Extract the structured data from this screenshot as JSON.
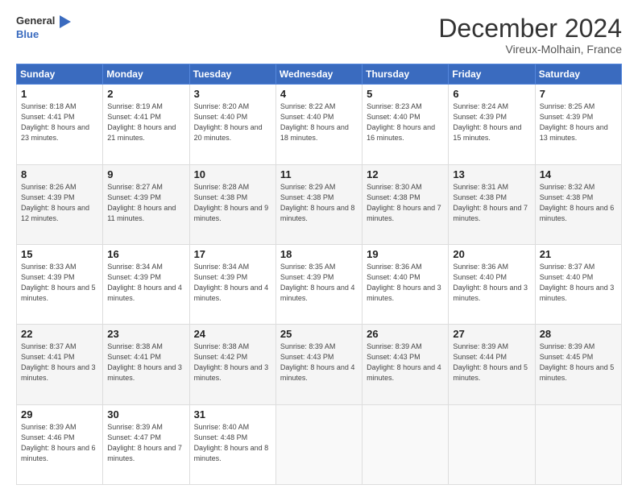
{
  "header": {
    "logo_line1": "General",
    "logo_line2": "Blue",
    "month": "December 2024",
    "location": "Vireux-Molhain, France"
  },
  "days_of_week": [
    "Sunday",
    "Monday",
    "Tuesday",
    "Wednesday",
    "Thursday",
    "Friday",
    "Saturday"
  ],
  "weeks": [
    [
      {
        "day": "1",
        "sunrise": "8:18 AM",
        "sunset": "4:41 PM",
        "daylight": "8 hours and 23 minutes."
      },
      {
        "day": "2",
        "sunrise": "8:19 AM",
        "sunset": "4:41 PM",
        "daylight": "8 hours and 21 minutes."
      },
      {
        "day": "3",
        "sunrise": "8:20 AM",
        "sunset": "4:40 PM",
        "daylight": "8 hours and 20 minutes."
      },
      {
        "day": "4",
        "sunrise": "8:22 AM",
        "sunset": "4:40 PM",
        "daylight": "8 hours and 18 minutes."
      },
      {
        "day": "5",
        "sunrise": "8:23 AM",
        "sunset": "4:40 PM",
        "daylight": "8 hours and 16 minutes."
      },
      {
        "day": "6",
        "sunrise": "8:24 AM",
        "sunset": "4:39 PM",
        "daylight": "8 hours and 15 minutes."
      },
      {
        "day": "7",
        "sunrise": "8:25 AM",
        "sunset": "4:39 PM",
        "daylight": "8 hours and 13 minutes."
      }
    ],
    [
      {
        "day": "8",
        "sunrise": "8:26 AM",
        "sunset": "4:39 PM",
        "daylight": "8 hours and 12 minutes."
      },
      {
        "day": "9",
        "sunrise": "8:27 AM",
        "sunset": "4:39 PM",
        "daylight": "8 hours and 11 minutes."
      },
      {
        "day": "10",
        "sunrise": "8:28 AM",
        "sunset": "4:38 PM",
        "daylight": "8 hours and 9 minutes."
      },
      {
        "day": "11",
        "sunrise": "8:29 AM",
        "sunset": "4:38 PM",
        "daylight": "8 hours and 8 minutes."
      },
      {
        "day": "12",
        "sunrise": "8:30 AM",
        "sunset": "4:38 PM",
        "daylight": "8 hours and 7 minutes."
      },
      {
        "day": "13",
        "sunrise": "8:31 AM",
        "sunset": "4:38 PM",
        "daylight": "8 hours and 7 minutes."
      },
      {
        "day": "14",
        "sunrise": "8:32 AM",
        "sunset": "4:38 PM",
        "daylight": "8 hours and 6 minutes."
      }
    ],
    [
      {
        "day": "15",
        "sunrise": "8:33 AM",
        "sunset": "4:39 PM",
        "daylight": "8 hours and 5 minutes."
      },
      {
        "day": "16",
        "sunrise": "8:34 AM",
        "sunset": "4:39 PM",
        "daylight": "8 hours and 4 minutes."
      },
      {
        "day": "17",
        "sunrise": "8:34 AM",
        "sunset": "4:39 PM",
        "daylight": "8 hours and 4 minutes."
      },
      {
        "day": "18",
        "sunrise": "8:35 AM",
        "sunset": "4:39 PM",
        "daylight": "8 hours and 4 minutes."
      },
      {
        "day": "19",
        "sunrise": "8:36 AM",
        "sunset": "4:40 PM",
        "daylight": "8 hours and 3 minutes."
      },
      {
        "day": "20",
        "sunrise": "8:36 AM",
        "sunset": "4:40 PM",
        "daylight": "8 hours and 3 minutes."
      },
      {
        "day": "21",
        "sunrise": "8:37 AM",
        "sunset": "4:40 PM",
        "daylight": "8 hours and 3 minutes."
      }
    ],
    [
      {
        "day": "22",
        "sunrise": "8:37 AM",
        "sunset": "4:41 PM",
        "daylight": "8 hours and 3 minutes."
      },
      {
        "day": "23",
        "sunrise": "8:38 AM",
        "sunset": "4:41 PM",
        "daylight": "8 hours and 3 minutes."
      },
      {
        "day": "24",
        "sunrise": "8:38 AM",
        "sunset": "4:42 PM",
        "daylight": "8 hours and 3 minutes."
      },
      {
        "day": "25",
        "sunrise": "8:39 AM",
        "sunset": "4:43 PM",
        "daylight": "8 hours and 4 minutes."
      },
      {
        "day": "26",
        "sunrise": "8:39 AM",
        "sunset": "4:43 PM",
        "daylight": "8 hours and 4 minutes."
      },
      {
        "day": "27",
        "sunrise": "8:39 AM",
        "sunset": "4:44 PM",
        "daylight": "8 hours and 5 minutes."
      },
      {
        "day": "28",
        "sunrise": "8:39 AM",
        "sunset": "4:45 PM",
        "daylight": "8 hours and 5 minutes."
      }
    ],
    [
      {
        "day": "29",
        "sunrise": "8:39 AM",
        "sunset": "4:46 PM",
        "daylight": "8 hours and 6 minutes."
      },
      {
        "day": "30",
        "sunrise": "8:39 AM",
        "sunset": "4:47 PM",
        "daylight": "8 hours and 7 minutes."
      },
      {
        "day": "31",
        "sunrise": "8:40 AM",
        "sunset": "4:48 PM",
        "daylight": "8 hours and 8 minutes."
      },
      null,
      null,
      null,
      null
    ]
  ],
  "labels": {
    "sunrise": "Sunrise:",
    "sunset": "Sunset:",
    "daylight": "Daylight:"
  }
}
